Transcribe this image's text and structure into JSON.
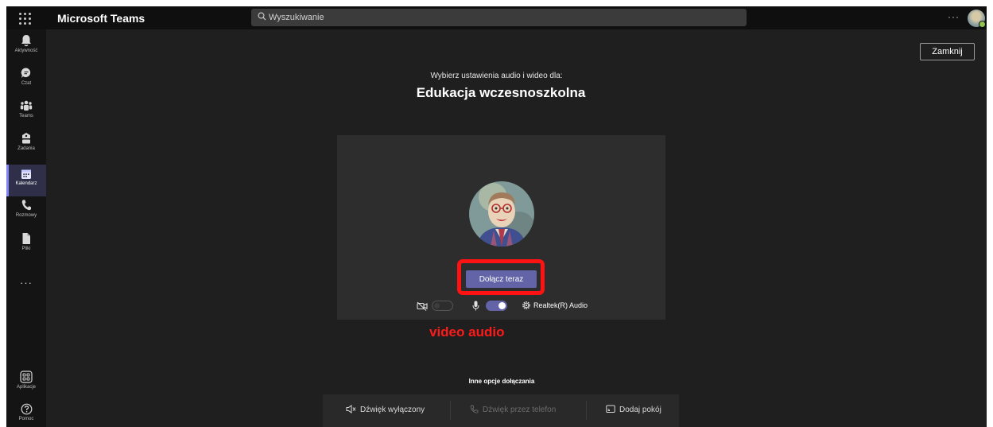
{
  "header": {
    "app_title": "Microsoft Teams",
    "search_placeholder": "Wyszukiwanie",
    "more_label": "···"
  },
  "rail": {
    "items": [
      {
        "label": "Aktywność",
        "icon": "bell-icon"
      },
      {
        "label": "Czat",
        "icon": "chat-icon"
      },
      {
        "label": "Teams",
        "icon": "teams-icon"
      },
      {
        "label": "Zadania",
        "icon": "assignments-icon"
      },
      {
        "label": "Kalendarz",
        "icon": "calendar-icon",
        "active": true
      },
      {
        "label": "Rozmowy",
        "icon": "phone-icon"
      },
      {
        "label": "Pliki",
        "icon": "file-icon"
      }
    ],
    "more": "···",
    "bottom": [
      {
        "label": "Aplikacje",
        "icon": "apps-icon"
      },
      {
        "label": "Pomoc",
        "icon": "help-icon"
      }
    ]
  },
  "main": {
    "close_label": "Zamknij",
    "subtitle": "Wybierz ustawienia audio i wideo dla:",
    "meeting_title": "Edukacja wczesnoszkolna",
    "join_label": "Dołącz teraz",
    "video_enabled": false,
    "audio_enabled": true,
    "device_label": "Realtek(R) Audio",
    "annotation": "video audio",
    "other_options_title": "Inne opcje dołączania",
    "other_options": [
      {
        "label": "Dźwięk wyłączony",
        "icon": "speaker-off-icon",
        "disabled": false
      },
      {
        "label": "Dźwięk przez telefon",
        "icon": "phone-audio-icon",
        "disabled": true
      },
      {
        "label": "Dodaj pokój",
        "icon": "cast-room-icon",
        "disabled": false
      }
    ]
  },
  "colors": {
    "accent": "#6264a7",
    "highlight": "#ff1212",
    "background": "#1f1f1f"
  }
}
